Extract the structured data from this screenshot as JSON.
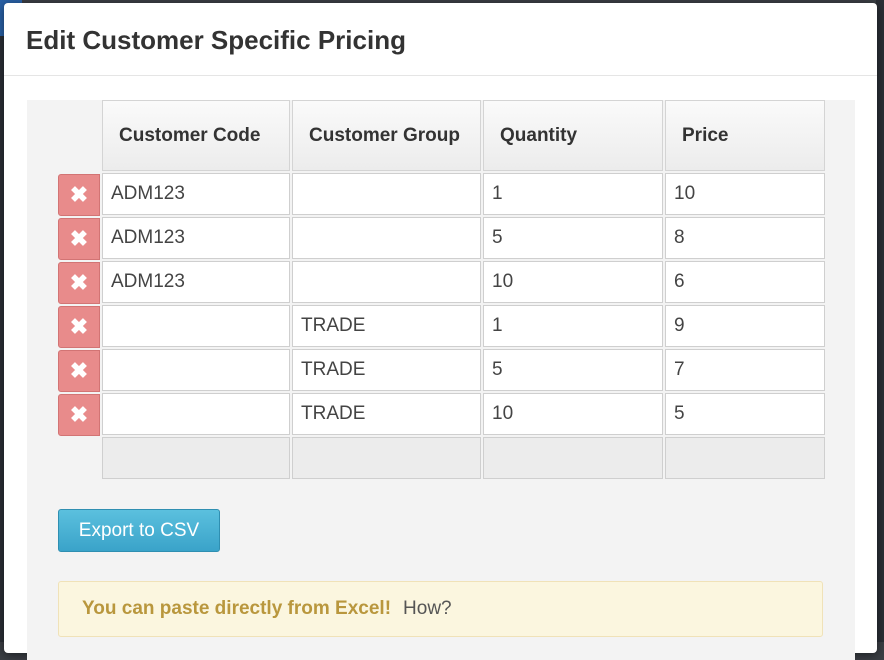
{
  "modal": {
    "title": "Edit Customer Specific Pricing"
  },
  "table": {
    "headers": [
      "Customer Code",
      "Customer Group",
      "Quantity",
      "Price"
    ],
    "rows": [
      {
        "customer_code": "ADM123",
        "customer_group": "",
        "quantity": "1",
        "price": "10"
      },
      {
        "customer_code": "ADM123",
        "customer_group": "",
        "quantity": "5",
        "price": "8"
      },
      {
        "customer_code": "ADM123",
        "customer_group": "",
        "quantity": "10",
        "price": "6"
      },
      {
        "customer_code": "",
        "customer_group": "TRADE",
        "quantity": "1",
        "price": "9"
      },
      {
        "customer_code": "",
        "customer_group": "TRADE",
        "quantity": "5",
        "price": "7"
      },
      {
        "customer_code": "",
        "customer_group": "TRADE",
        "quantity": "10",
        "price": "5"
      }
    ]
  },
  "delete_icon": "close-icon",
  "delete_glyph": "✖",
  "export_button": {
    "label": "Export to CSV"
  },
  "paste_note": {
    "text": "You can paste directly from Excel!",
    "link": "How?"
  },
  "colors": {
    "delete_button": "#e88b8b",
    "export_button": "#5bc0de",
    "note_background": "#fbf6df",
    "note_text": "#b9973d"
  }
}
